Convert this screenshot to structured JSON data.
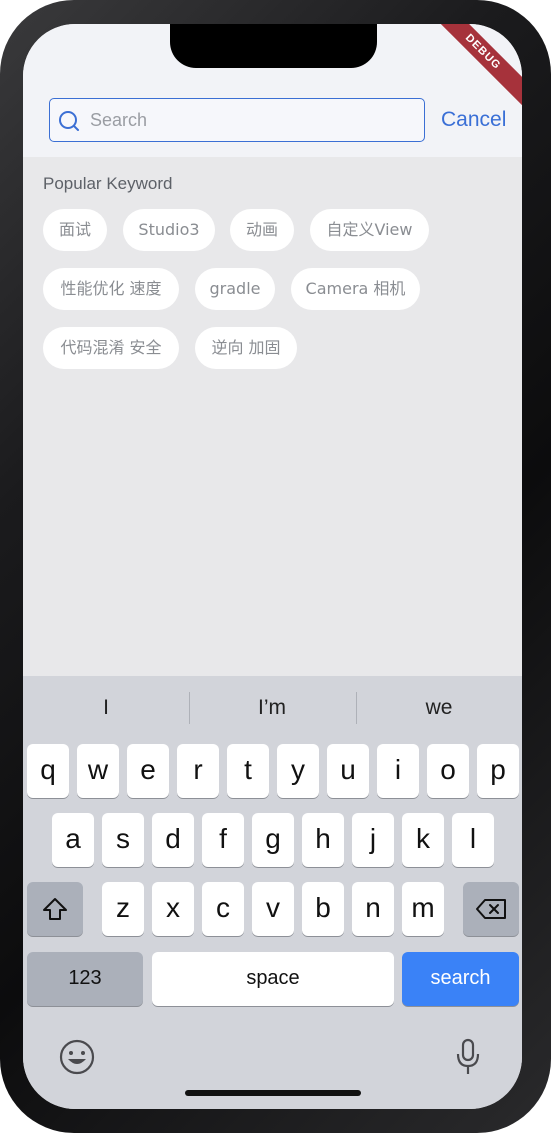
{
  "debug_banner": "DEBUG",
  "search": {
    "placeholder": "Search",
    "value": "",
    "cancel_label": "Cancel"
  },
  "popular": {
    "title": "Popular Keyword",
    "chips": [
      "面试",
      "Studio3",
      "动画",
      "自定义View",
      "性能优化 速度",
      "gradle",
      "Camera 相机",
      "代码混淆 安全",
      "逆向 加固"
    ]
  },
  "keyboard": {
    "suggestions": [
      "I",
      "I’m",
      "we"
    ],
    "row1": [
      "q",
      "w",
      "e",
      "r",
      "t",
      "y",
      "u",
      "i",
      "o",
      "p"
    ],
    "row2": [
      "a",
      "s",
      "d",
      "f",
      "g",
      "h",
      "j",
      "k",
      "l"
    ],
    "row3": [
      "z",
      "x",
      "c",
      "v",
      "b",
      "n",
      "m"
    ],
    "numbers_label": "123",
    "space_label": "space",
    "action_label": "search"
  },
  "icons": {
    "search": "search-icon",
    "shift": "shift-icon",
    "backspace": "backspace-icon",
    "emoji": "emoji-icon",
    "microphone": "microphone-icon"
  },
  "colors": {
    "accent": "#3a6fd6",
    "action_key": "#3a82f7",
    "debug_ribbon": "#a6323b"
  }
}
